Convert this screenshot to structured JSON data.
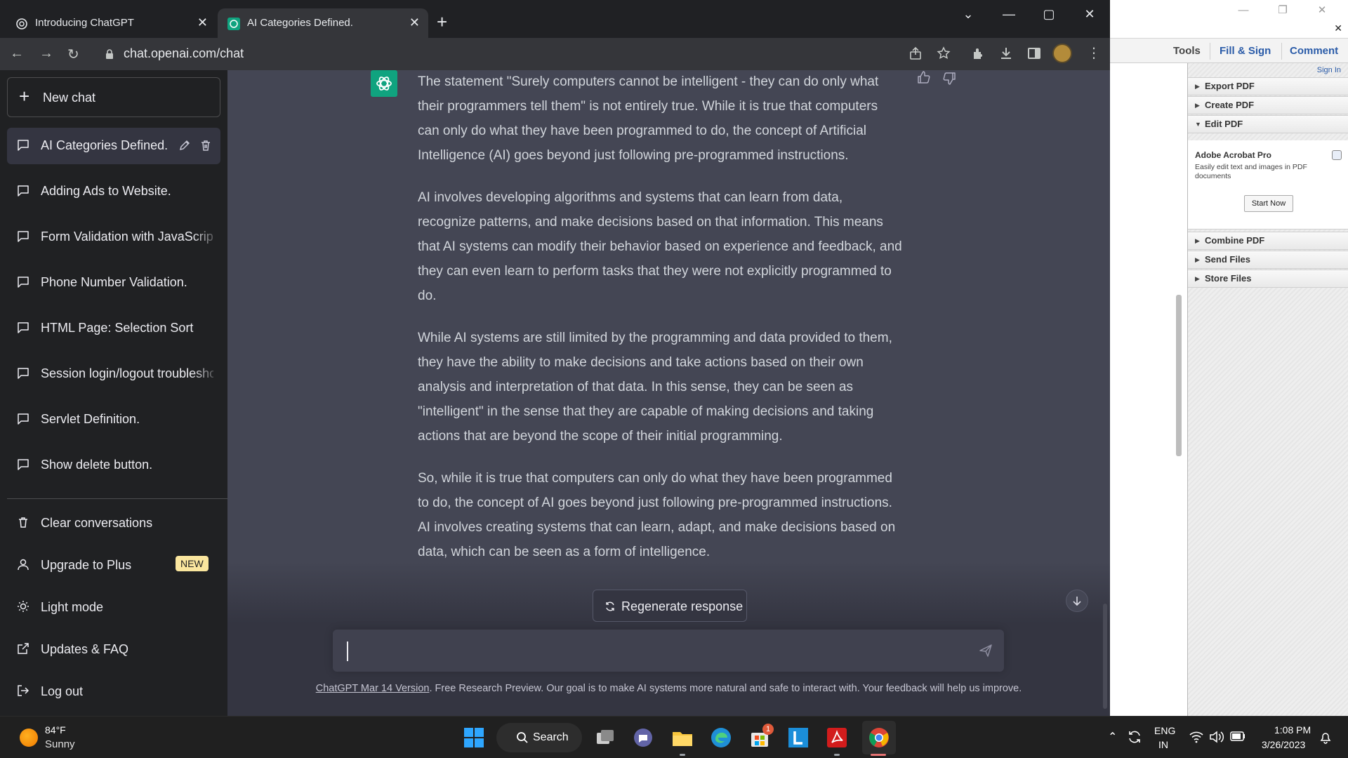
{
  "browser": {
    "tabs": [
      {
        "title": "Introducing ChatGPT"
      },
      {
        "title": "AI Categories Defined."
      }
    ],
    "url": "chat.openai.com/chat"
  },
  "sidebar": {
    "new_chat": "New chat",
    "conversations": [
      {
        "title": "AI Categories Defined.",
        "active": true
      },
      {
        "title": "Adding Ads to Website."
      },
      {
        "title": "Form Validation with JavaScript"
      },
      {
        "title": "Phone Number Validation."
      },
      {
        "title": "HTML Page: Selection Sort"
      },
      {
        "title": "Session login/logout troubleshooting"
      },
      {
        "title": "Servlet Definition."
      },
      {
        "title": "Show delete button."
      }
    ],
    "bottom": {
      "clear": "Clear conversations",
      "upgrade": "Upgrade to Plus",
      "upgrade_badge": "NEW",
      "light_mode": "Light mode",
      "updates": "Updates & FAQ",
      "logout": "Log out"
    }
  },
  "message": {
    "paragraphs": [
      "The statement \"Surely computers cannot be intelligent - they can do only what their programmers tell them\" is not entirely true. While it is true that computers can only do what they have been programmed to do, the concept of Artificial Intelligence (AI) goes beyond just following pre-programmed instructions.",
      "AI involves developing algorithms and systems that can learn from data, recognize patterns, and make decisions based on that information. This means that AI systems can modify their behavior based on experience and feedback, and they can even learn to perform tasks that they were not explicitly programmed to do.",
      "While AI systems are still limited by the programming and data provided to them, they have the ability to make decisions and take actions based on their own analysis and interpretation of that data. In this sense, they can be seen as \"intelligent\" in the sense that they are capable of making decisions and taking actions that are beyond the scope of their initial programming.",
      "So, while it is true that computers can only do what they have been programmed to do, the concept of AI goes beyond just following pre-programmed instructions. AI involves creating systems that can learn, adapt, and make decisions based on data, which can be seen as a form of intelligence."
    ]
  },
  "composer": {
    "regenerate": "Regenerate response",
    "footer_link": "ChatGPT Mar 14 Version",
    "footer_text": ". Free Research Preview. Our goal is to make AI systems more natural and safe to interact with. Your feedback will help us improve."
  },
  "acrobat": {
    "toolbar": {
      "tools": "Tools",
      "fill_sign": "Fill & Sign",
      "comment": "Comment"
    },
    "sign_in": "Sign In",
    "sections": [
      "Export PDF",
      "Create PDF",
      "Edit PDF",
      "Combine PDF",
      "Send Files",
      "Store Files"
    ],
    "pro_title": "Adobe Acrobat Pro",
    "pro_desc": "Easily edit text and images in PDF documents",
    "start_now": "Start Now"
  },
  "taskbar": {
    "weather_temp": "84°F",
    "weather_cond": "Sunny",
    "search": "Search",
    "lang_top": "ENG",
    "lang_bottom": "IN",
    "time": "1:08 PM",
    "date": "3/26/2023",
    "store_badge": "1"
  },
  "colors": {
    "gpt_green": "#10a37f",
    "page_bg": "#343541",
    "assistant_bg": "#444654",
    "sidebar_bg": "#202123"
  }
}
